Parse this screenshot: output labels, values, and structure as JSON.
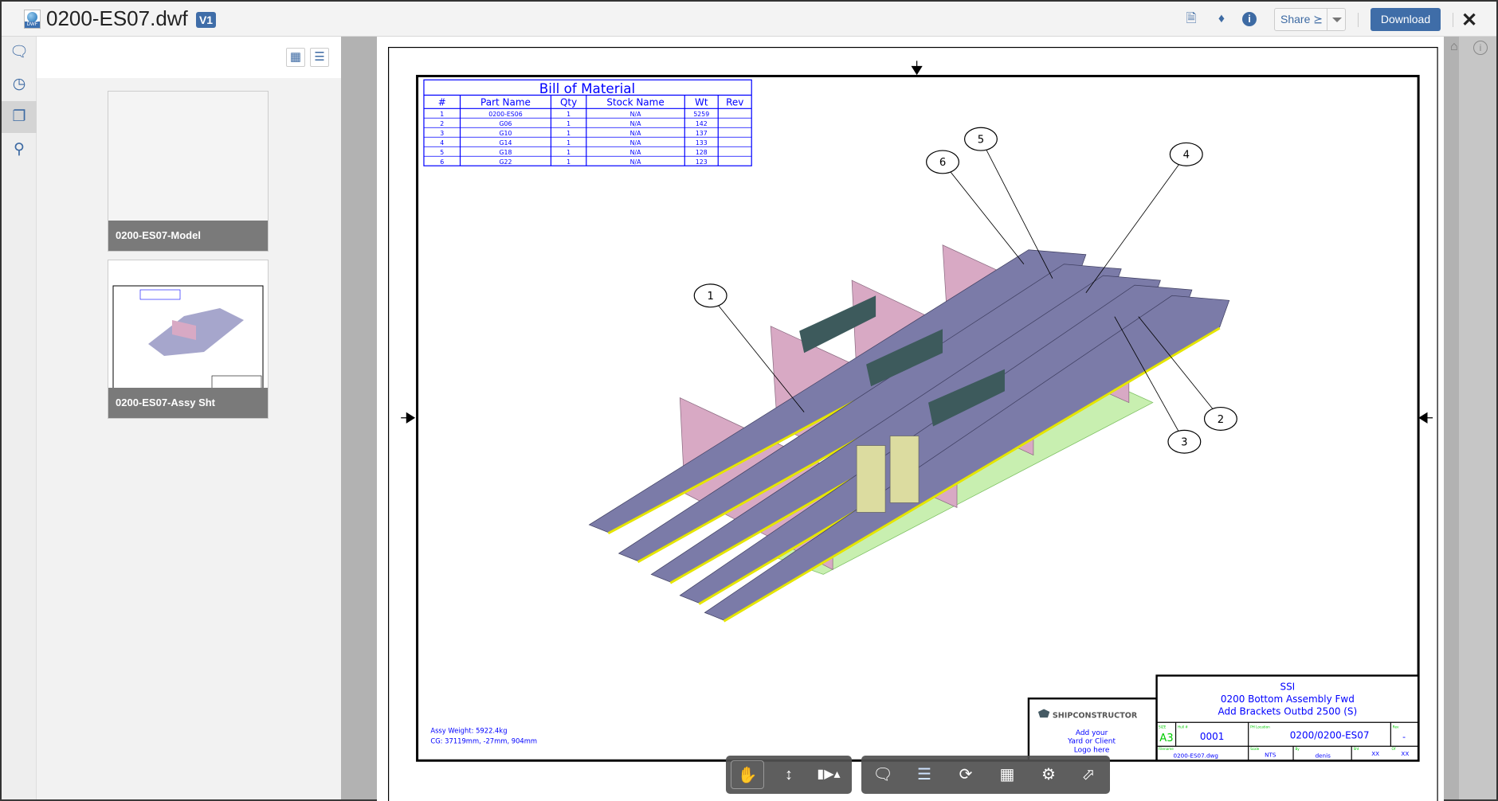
{
  "header": {
    "file_name": "0200-ES07.dwf",
    "file_type": "DWF",
    "version": "V1",
    "share_label": "Share",
    "download_label": "Download",
    "icons": [
      "file-download-icon",
      "tag-icon",
      "info-icon",
      "share-icon",
      "caret-down-icon",
      "close-icon"
    ]
  },
  "rail": {
    "items": [
      {
        "name": "comments",
        "icon": "comments-icon"
      },
      {
        "name": "history",
        "icon": "clock-icon"
      },
      {
        "name": "sheets",
        "icon": "pages-icon",
        "active": true
      },
      {
        "name": "search",
        "icon": "search-icon"
      }
    ]
  },
  "thumbnails": {
    "view_toggles": [
      "grid-view-icon",
      "list-view-icon"
    ],
    "items": [
      {
        "label": "0200-ES07-Model"
      },
      {
        "label": "0200-ES07-Assy Sht"
      }
    ]
  },
  "bom": {
    "title": "Bill of Material",
    "columns": [
      "#",
      "Part Name",
      "Qty",
      "Stock Name",
      "Wt",
      "Rev"
    ],
    "rows": [
      [
        "1",
        "0200-ES06",
        "1",
        "N/A",
        "5259",
        ""
      ],
      [
        "2",
        "G06",
        "1",
        "N/A",
        "142",
        ""
      ],
      [
        "3",
        "G10",
        "1",
        "N/A",
        "137",
        ""
      ],
      [
        "4",
        "G14",
        "1",
        "N/A",
        "133",
        ""
      ],
      [
        "5",
        "G18",
        "1",
        "N/A",
        "128",
        ""
      ],
      [
        "6",
        "G22",
        "1",
        "N/A",
        "123",
        ""
      ]
    ]
  },
  "callouts": [
    "1",
    "2",
    "3",
    "4",
    "5",
    "6"
  ],
  "notes": {
    "weight": "Assy Weight: 5922.4kg",
    "cg": "CG: 37119mm, -27mm, 904mm"
  },
  "logo": {
    "brand": "SHIPCONSTRUCTOR",
    "text1": "Add your",
    "text2": "Yard or Client",
    "text3": "Logo here"
  },
  "title_block": {
    "company": "SSI",
    "title1": "0200 Bottom Assembly Fwd",
    "title2": "Add Brackets Outbd 2500 (S)",
    "size_label": "SIZE",
    "size": "A3",
    "hull_label": "Hull #",
    "hull": "0001",
    "location_label": "PH Location",
    "location": "0200/0200-ES07",
    "rev_label": "Rev",
    "rev": "-",
    "filename_label": "Filename",
    "filename": "0200-ES07.dwg",
    "scale_label": "Scale",
    "scale": "NTS",
    "by_label": "By",
    "by": "denis",
    "sht_label": "Sht",
    "sht": "XX",
    "of_label": "Of",
    "of": "XX"
  },
  "toolbar": {
    "tools": [
      "pan-icon",
      "zoom-icon",
      "camera-icon",
      "markup-icon",
      "layers-icon",
      "refresh-icon",
      "properties-icon",
      "settings-icon",
      "fullscreen-icon"
    ]
  },
  "colors": {
    "accent": "#3f6da8",
    "bom_blue": "#0000ff",
    "girder": "#7b7ba8",
    "floor": "#d8a9c4",
    "deck": "#c8efb0",
    "bracket": "#3d5a5c"
  }
}
